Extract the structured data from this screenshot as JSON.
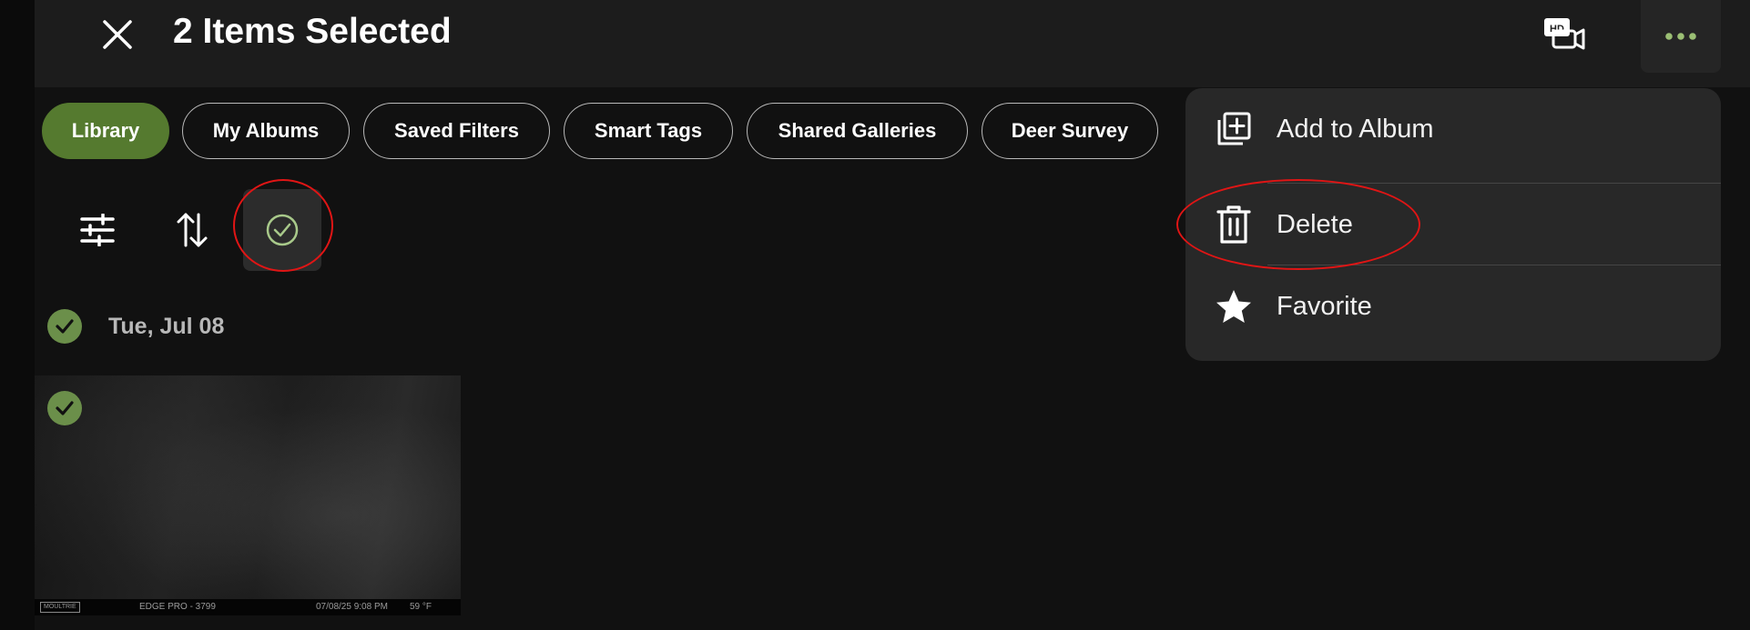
{
  "header": {
    "title": "2 Items Selected",
    "close_icon": "close-icon",
    "hd_video_icon": "hd-video-icon",
    "more_icon": "more-horizontal-icon"
  },
  "chips": [
    {
      "label": "Library",
      "active": true
    },
    {
      "label": "My Albums",
      "active": false
    },
    {
      "label": "Saved Filters",
      "active": false
    },
    {
      "label": "Smart Tags",
      "active": false
    },
    {
      "label": "Shared Galleries",
      "active": false
    },
    {
      "label": "Deer Survey",
      "active": false
    }
  ],
  "toolbar": {
    "filter_icon": "sliders-icon",
    "sort_icon": "sort-arrows-icon",
    "select_icon": "check-circle-icon"
  },
  "gallery": {
    "date_label": "Tue, Jul 08",
    "photo": {
      "brand": "MOULTRIE",
      "camera": "EDGE PRO - 3799",
      "timestamp": "07/08/25 9:08 PM",
      "temperature": "59 °F"
    }
  },
  "menu": {
    "items": [
      {
        "label": "Add to Album",
        "icon": "add-to-album-icon"
      },
      {
        "label": "Delete",
        "icon": "trash-icon"
      },
      {
        "label": "Favorite",
        "icon": "star-icon"
      }
    ]
  },
  "colors": {
    "accent_green": "#557a2f",
    "check_green": "#6b8f4a",
    "annotation_red": "#e01515",
    "background": "#111111",
    "menu_background": "#282828"
  }
}
